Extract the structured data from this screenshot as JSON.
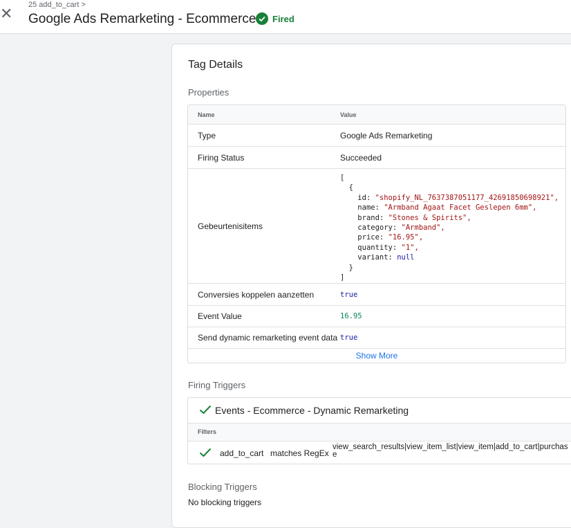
{
  "header": {
    "breadcrumb": "25 add_to_cart >",
    "title": "Google Ads Remarketing - Ecommerce",
    "status": "Fired",
    "status_color": "#188038",
    "close_icon": "close-icon",
    "status_icon": "check-circle-icon"
  },
  "tag_details": {
    "title": "Tag Details",
    "properties_label": "Properties",
    "table": {
      "col_name": "Name",
      "col_value": "Value",
      "type_name": "Type",
      "type_value": "Google Ads Remarketing",
      "status_name": "Firing Status",
      "status_value": "Succeeded",
      "items_name": "Gebeurtenisitems",
      "items": {
        "open_bracket": "[",
        "open_brace": "{",
        "id_key": "id:",
        "id_value": "\"shopify_NL_7637387051177_42691850698921\",",
        "name_key": "name:",
        "name_value": "\"Armband Agaat Facet Geslepen 6mm\",",
        "brand_key": "brand:",
        "brand_value": "\"Stones & Spirits\",",
        "category_key": "category:",
        "category_value": "\"Armband\",",
        "price_key": "price:",
        "price_value": "\"16.95\",",
        "quantity_key": "quantity:",
        "quantity_value": "\"1\",",
        "variant_key": "variant:",
        "variant_value": "null",
        "close_brace": "}",
        "close_bracket": "]"
      },
      "conv_name": "Conversies koppelen aanzetten",
      "conv_value": "true",
      "event_name": "Event Value",
      "event_value": "16.95",
      "dyn_name": "Send dynamic remarketing event data",
      "dyn_value": "true",
      "show_more": "Show More"
    },
    "firing_label": "Firing Triggers",
    "trigger": {
      "name": "Events - Ecommerce - Dynamic Remarketing",
      "filters_label": "Filters",
      "filter_variable": "add_to_cart",
      "filter_operator": "matches RegEx",
      "filter_value": "view_search_results|view_item_list|view_item|add_to_cart|purchase"
    },
    "blocking_label": "Blocking Triggers",
    "blocking_text": "No blocking triggers"
  }
}
